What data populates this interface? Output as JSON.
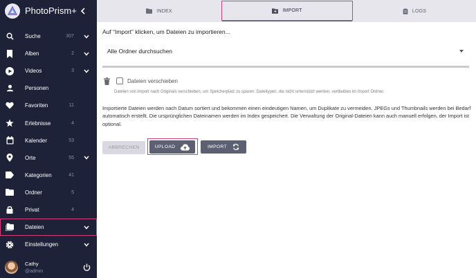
{
  "app": {
    "title": "PhotoPrism+"
  },
  "sidebar": {
    "items": [
      {
        "label": "Suche",
        "count": "307",
        "icon": "search-icon",
        "chevron": true
      },
      {
        "label": "Alben",
        "count": "2",
        "icon": "bookmark-icon",
        "chevron": true
      },
      {
        "label": "Videos",
        "count": "3",
        "icon": "play-circle-icon",
        "chevron": true
      },
      {
        "label": "Personen",
        "count": "",
        "icon": "person-icon",
        "chevron": false
      },
      {
        "label": "Favoriten",
        "count": "11",
        "icon": "heart-icon",
        "chevron": false
      },
      {
        "label": "Erlebnisse",
        "count": "4",
        "icon": "star-icon",
        "chevron": false
      },
      {
        "label": "Kalender",
        "count": "53",
        "icon": "calendar-icon",
        "chevron": false
      },
      {
        "label": "Orte",
        "count": "55",
        "icon": "map-pin-icon",
        "chevron": true
      },
      {
        "label": "Kategorien",
        "count": "41",
        "icon": "label-icon",
        "chevron": false
      },
      {
        "label": "Ordner",
        "count": "5",
        "icon": "folder-icon",
        "chevron": false
      },
      {
        "label": "Privat",
        "count": "4",
        "icon": "lock-icon",
        "chevron": false
      },
      {
        "label": "Dateien",
        "count": "",
        "icon": "file-folder-icon",
        "chevron": true
      },
      {
        "label": "Einstellungen",
        "count": "",
        "icon": "gear-icon",
        "chevron": true
      }
    ],
    "active": "Dateien"
  },
  "user": {
    "name": "Cathy",
    "handle": "@admin"
  },
  "tabs": [
    {
      "label": "INDEX",
      "icon": "folder-icon"
    },
    {
      "label": "IMPORT",
      "icon": "folder-import-icon",
      "active": true
    },
    {
      "label": "LOGS",
      "icon": "clipboard-icon"
    }
  ],
  "import": {
    "heading": "Auf “Import” klicken, um Dateien zu importieren...",
    "folder_select": "Alle Ordner durchsuchen",
    "move_label": "Dateien verschieben",
    "move_hint": "Dateien von Import nach Originals verschieben, um Speicherplatz zu sparen. Dateitypen, die nicht unterstützt werden, verbleiben im Import Ordner.",
    "description": "Importierte Dateien werden nach Datum sortiert und bekommen einen eindeutigen Namen, um Duplikate zu vermeiden. JPEGs und Thumbnails werden bei Bedarf automatisch erstellt. Die ursprünglichen Dateinamen werden im Index gespeichert. Die Verwaltung der Original-Dateien kann auch manuell erfolgen, der Import ist optional.",
    "buttons": {
      "abort": "ABBRECHEN",
      "upload": "UPLOAD",
      "import": "IMPORT"
    }
  },
  "colors": {
    "sidebar": "#1d2238",
    "accent": "#d6407a",
    "button": "#5d5f72"
  }
}
